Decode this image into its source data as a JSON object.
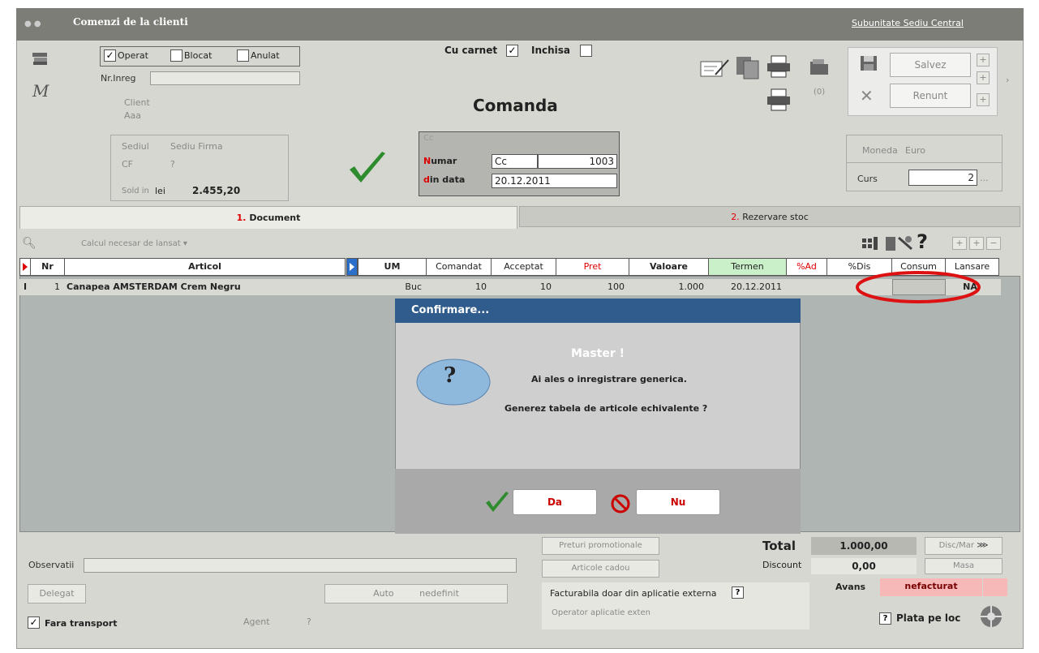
{
  "window": {
    "title": "Comenzi de la clienti",
    "subunit_link": "Subunitate Sediu Central"
  },
  "status": {
    "operat": "Operat",
    "blocat": "Blocat",
    "anulat": "Anulat",
    "operat_checked": true
  },
  "top": {
    "nr_inreg_label": "Nr.Inreg",
    "client_label": "Client",
    "client_value": "Aaa",
    "cu_carnet_label": "Cu carnet",
    "inchisa_label": "Inchisa",
    "doc_title": "Comanda",
    "attach_count": "(0)"
  },
  "sediu": {
    "sediul_label": "Sediul",
    "sediul_value": "Sediu Firma",
    "cf_label": "CF",
    "cf_value": "?",
    "sold_label": "Sold in",
    "sold_currency": "lei",
    "sold_value": "2.455,20"
  },
  "doc": {
    "cc_label": "Cc",
    "numar_label": "umar",
    "numar_prefix": "N",
    "numar_series": "Cc",
    "numar_value": "1003",
    "data_label": "in data",
    "data_prefix": "d",
    "data_value": "20.12.2011"
  },
  "actions": {
    "save": "Salvez",
    "cancel": "Renunt"
  },
  "currency": {
    "moneda_label": "Moneda",
    "moneda_value": "Euro",
    "curs_label": "Curs",
    "curs_value": "2",
    "ellipsis": "..."
  },
  "tabs": [
    {
      "num": "1.",
      "label": "Document"
    },
    {
      "num": "2.",
      "label": "Rezervare stoc"
    }
  ],
  "toolbar": {
    "calc_label": "Calcul necesar de lansat",
    "help": "?"
  },
  "table": {
    "headers": {
      "nr": "Nr",
      "articol": "Articol",
      "um": "UM",
      "comandat": "Comandat",
      "acceptat": "Acceptat",
      "pret": "Pret",
      "valoare": "Valoare",
      "termen": "Termen",
      "pad": "%Ad",
      "pdisc": "%Dis",
      "consum": "Consum",
      "lansare": "Lansare"
    },
    "rows": [
      {
        "nr": "1",
        "articol": "Canapea AMSTERDAM Crem Negru",
        "um": "Buc",
        "comandat": "10",
        "acceptat": "10",
        "pret": "100",
        "valoare": "1.000",
        "termen": "20.12.2011",
        "lansare": "NA"
      }
    ]
  },
  "dialog": {
    "title": "Confirmare...",
    "heading": "Master !",
    "line1": "Ai ales o inregistrare generica.",
    "line2": "Generez tabela de articole echivalente ?",
    "yes": "Da",
    "no": "Nu",
    "q": "?"
  },
  "bottom": {
    "observatii_label": "Observatii",
    "delegat": "Delegat",
    "auto": "Auto",
    "auto_value": "nedefinit",
    "fara_transport": "Fara transport",
    "agent_label": "Agent",
    "agent_value": "?",
    "preturi_promo": "Preturi promotionale",
    "articole_cadou": "Articole cadou",
    "facturabila": "Facturabila doar din aplicatie externa",
    "facturabila_q": "?",
    "operator": "Operator aplicatie exten",
    "total_label": "Total",
    "total_value": "1.000,00",
    "discount_label": "Discount",
    "discount_value": "0,00",
    "discmar": "Disc/Mar",
    "masa": "Masa",
    "avans_label": "Avans",
    "avans_value": "nefacturat",
    "plata_q": "?",
    "plata_label": "Plata pe loc"
  }
}
